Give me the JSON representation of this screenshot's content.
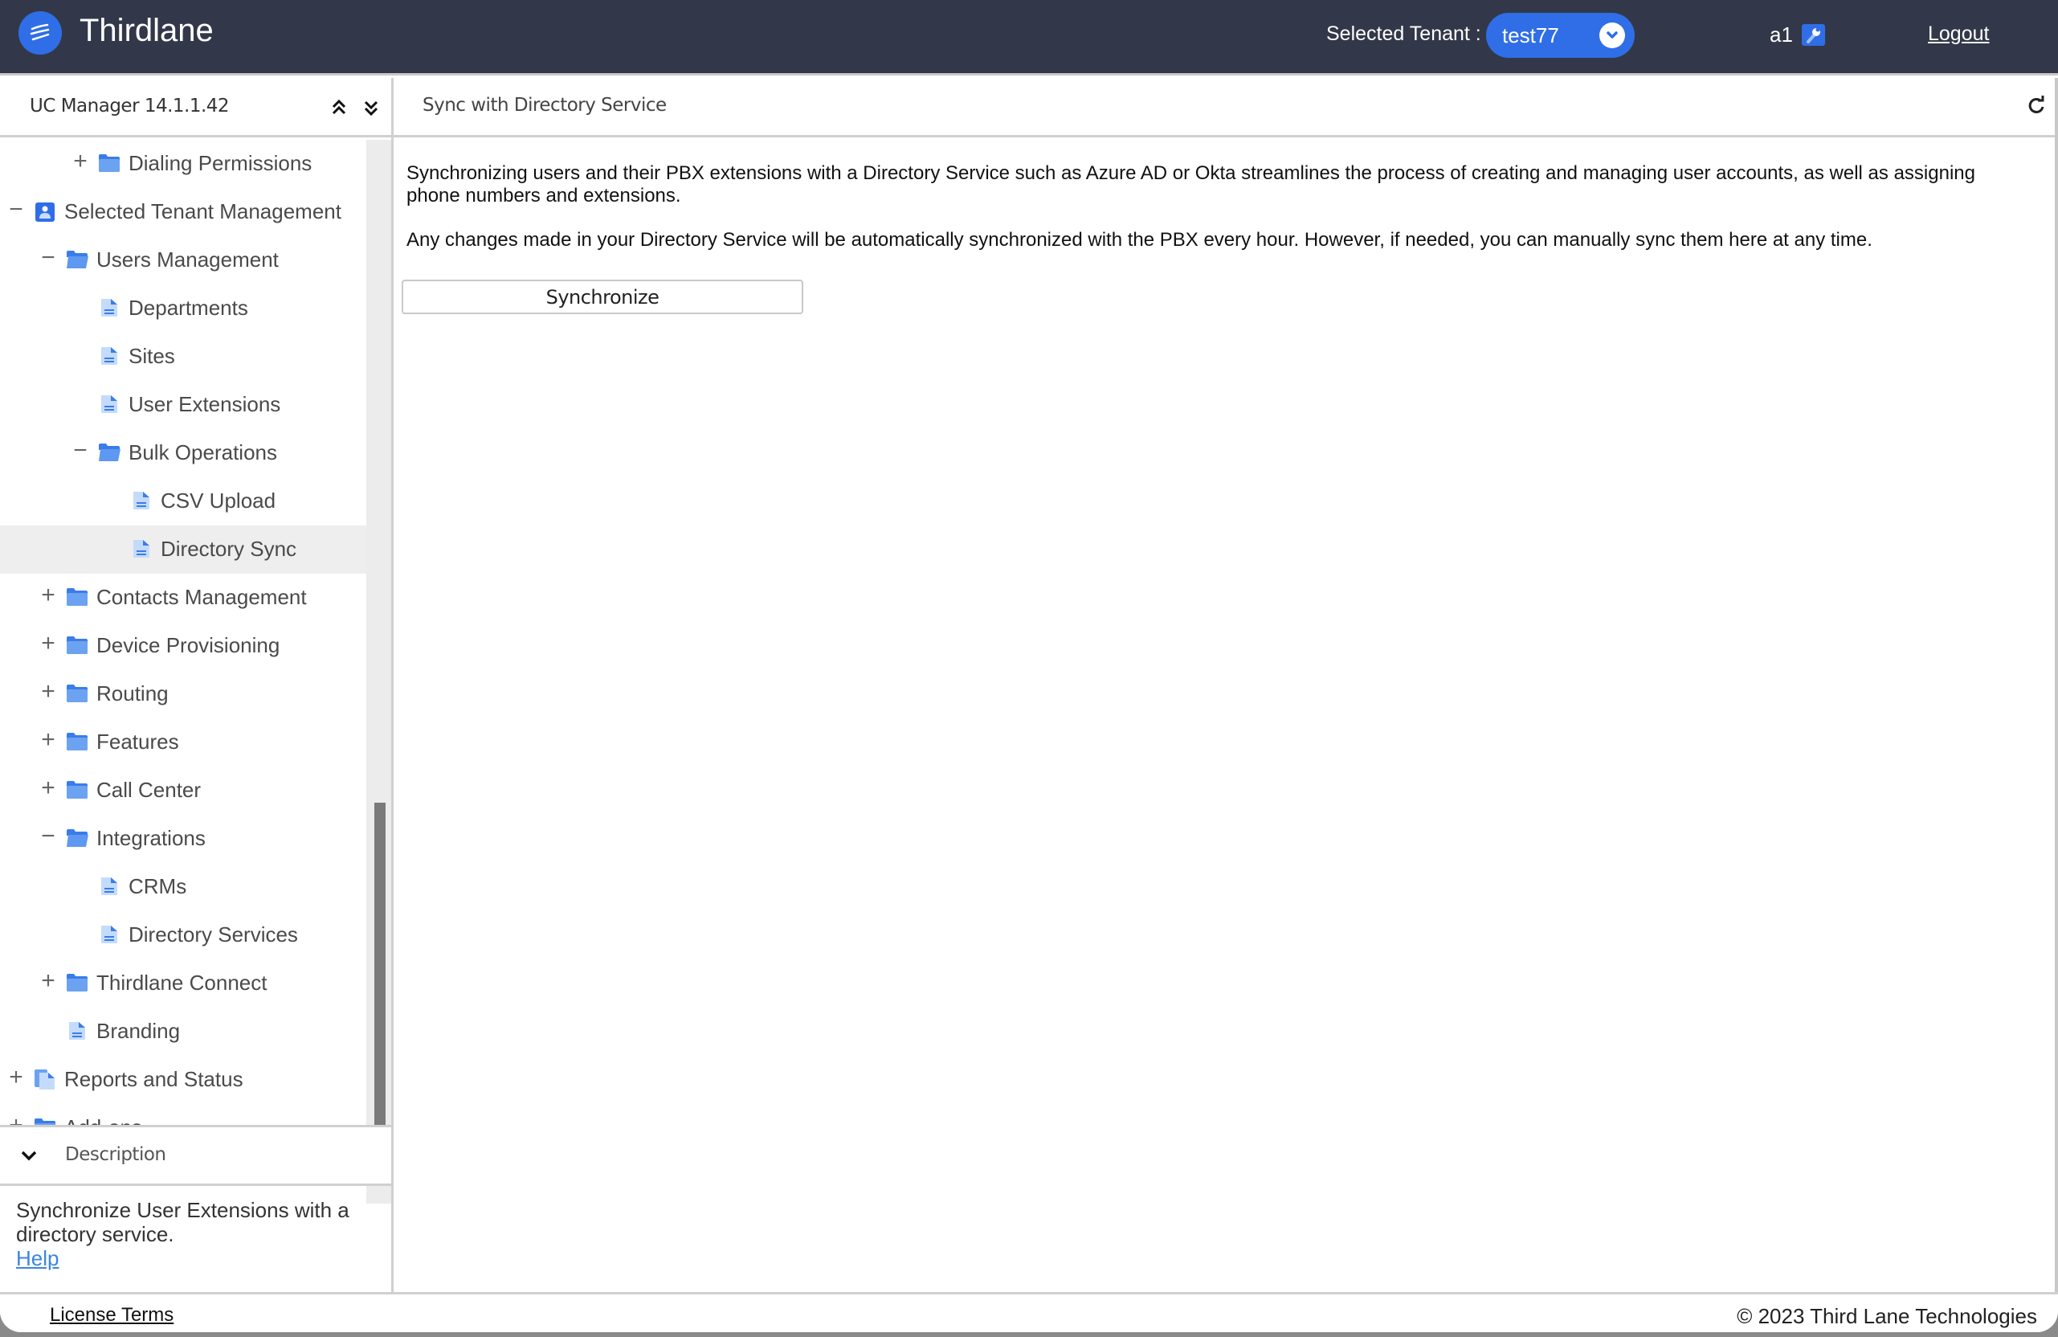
{
  "header": {
    "brand": "Thirdlane",
    "tenant_label": "Selected Tenant :",
    "tenant_value": "test77",
    "user": "a1",
    "logout": "Logout",
    "accent_color": "#2f6ee6",
    "bg_color": "#323849"
  },
  "sidebar": {
    "title": "UC Manager 14.1.1.42",
    "collapse_all_icon": "chevrons-up-icon",
    "expand_all_icon": "chevrons-down-icon",
    "tree": [
      {
        "label": "Dialing Permissions",
        "level": 2,
        "type": "folder",
        "toggle": "+"
      },
      {
        "label": "Selected Tenant Management",
        "level": 0,
        "type": "tenant",
        "toggle": "−"
      },
      {
        "label": "Users Management",
        "level": 1,
        "type": "folder-open",
        "toggle": "−"
      },
      {
        "label": "Departments",
        "level": 2,
        "type": "page",
        "toggle": ""
      },
      {
        "label": "Sites",
        "level": 2,
        "type": "page",
        "toggle": ""
      },
      {
        "label": "User Extensions",
        "level": 2,
        "type": "page",
        "toggle": ""
      },
      {
        "label": "Bulk Operations",
        "level": 2,
        "type": "folder-open",
        "toggle": "−"
      },
      {
        "label": "CSV Upload",
        "level": 3,
        "type": "page",
        "toggle": ""
      },
      {
        "label": "Directory Sync",
        "level": 3,
        "type": "page",
        "toggle": "",
        "selected": true
      },
      {
        "label": "Contacts Management",
        "level": 1,
        "type": "folder",
        "toggle": "+"
      },
      {
        "label": "Device Provisioning",
        "level": 1,
        "type": "folder",
        "toggle": "+"
      },
      {
        "label": "Routing",
        "level": 1,
        "type": "folder",
        "toggle": "+"
      },
      {
        "label": "Features",
        "level": 1,
        "type": "folder",
        "toggle": "+"
      },
      {
        "label": "Call Center",
        "level": 1,
        "type": "folder",
        "toggle": "+"
      },
      {
        "label": "Integrations",
        "level": 1,
        "type": "folder-open",
        "toggle": "−"
      },
      {
        "label": "CRMs",
        "level": 2,
        "type": "page",
        "toggle": ""
      },
      {
        "label": "Directory Services",
        "level": 2,
        "type": "page",
        "toggle": ""
      },
      {
        "label": "Thirdlane Connect",
        "level": 1,
        "type": "folder",
        "toggle": "+"
      },
      {
        "label": "Branding",
        "level": 1,
        "type": "page",
        "toggle": ""
      },
      {
        "label": "Reports and Status",
        "level": 0,
        "type": "pages",
        "toggle": "+"
      },
      {
        "label": "Add-ons",
        "level": 0,
        "type": "folder",
        "toggle": "+"
      }
    ],
    "description": {
      "title": "Description",
      "text": "Synchronize User Extensions with a directory service.",
      "help_link": "Help"
    }
  },
  "main": {
    "title": "Sync with Directory Service",
    "paragraphs": [
      "Synchronizing users and their PBX extensions with a Directory Service such as Azure AD or Okta streamlines the process of creating and managing user accounts, as well as assigning phone numbers and extensions.",
      "Any changes made in your Directory Service will be automatically synchronized with the PBX every hour. However, if needed, you can manually sync them here at any time."
    ],
    "sync_button": "Synchronize",
    "refresh_icon": "refresh-icon"
  },
  "footer": {
    "license": "License Terms",
    "copyright": "© 2023 Third Lane Technologies"
  }
}
